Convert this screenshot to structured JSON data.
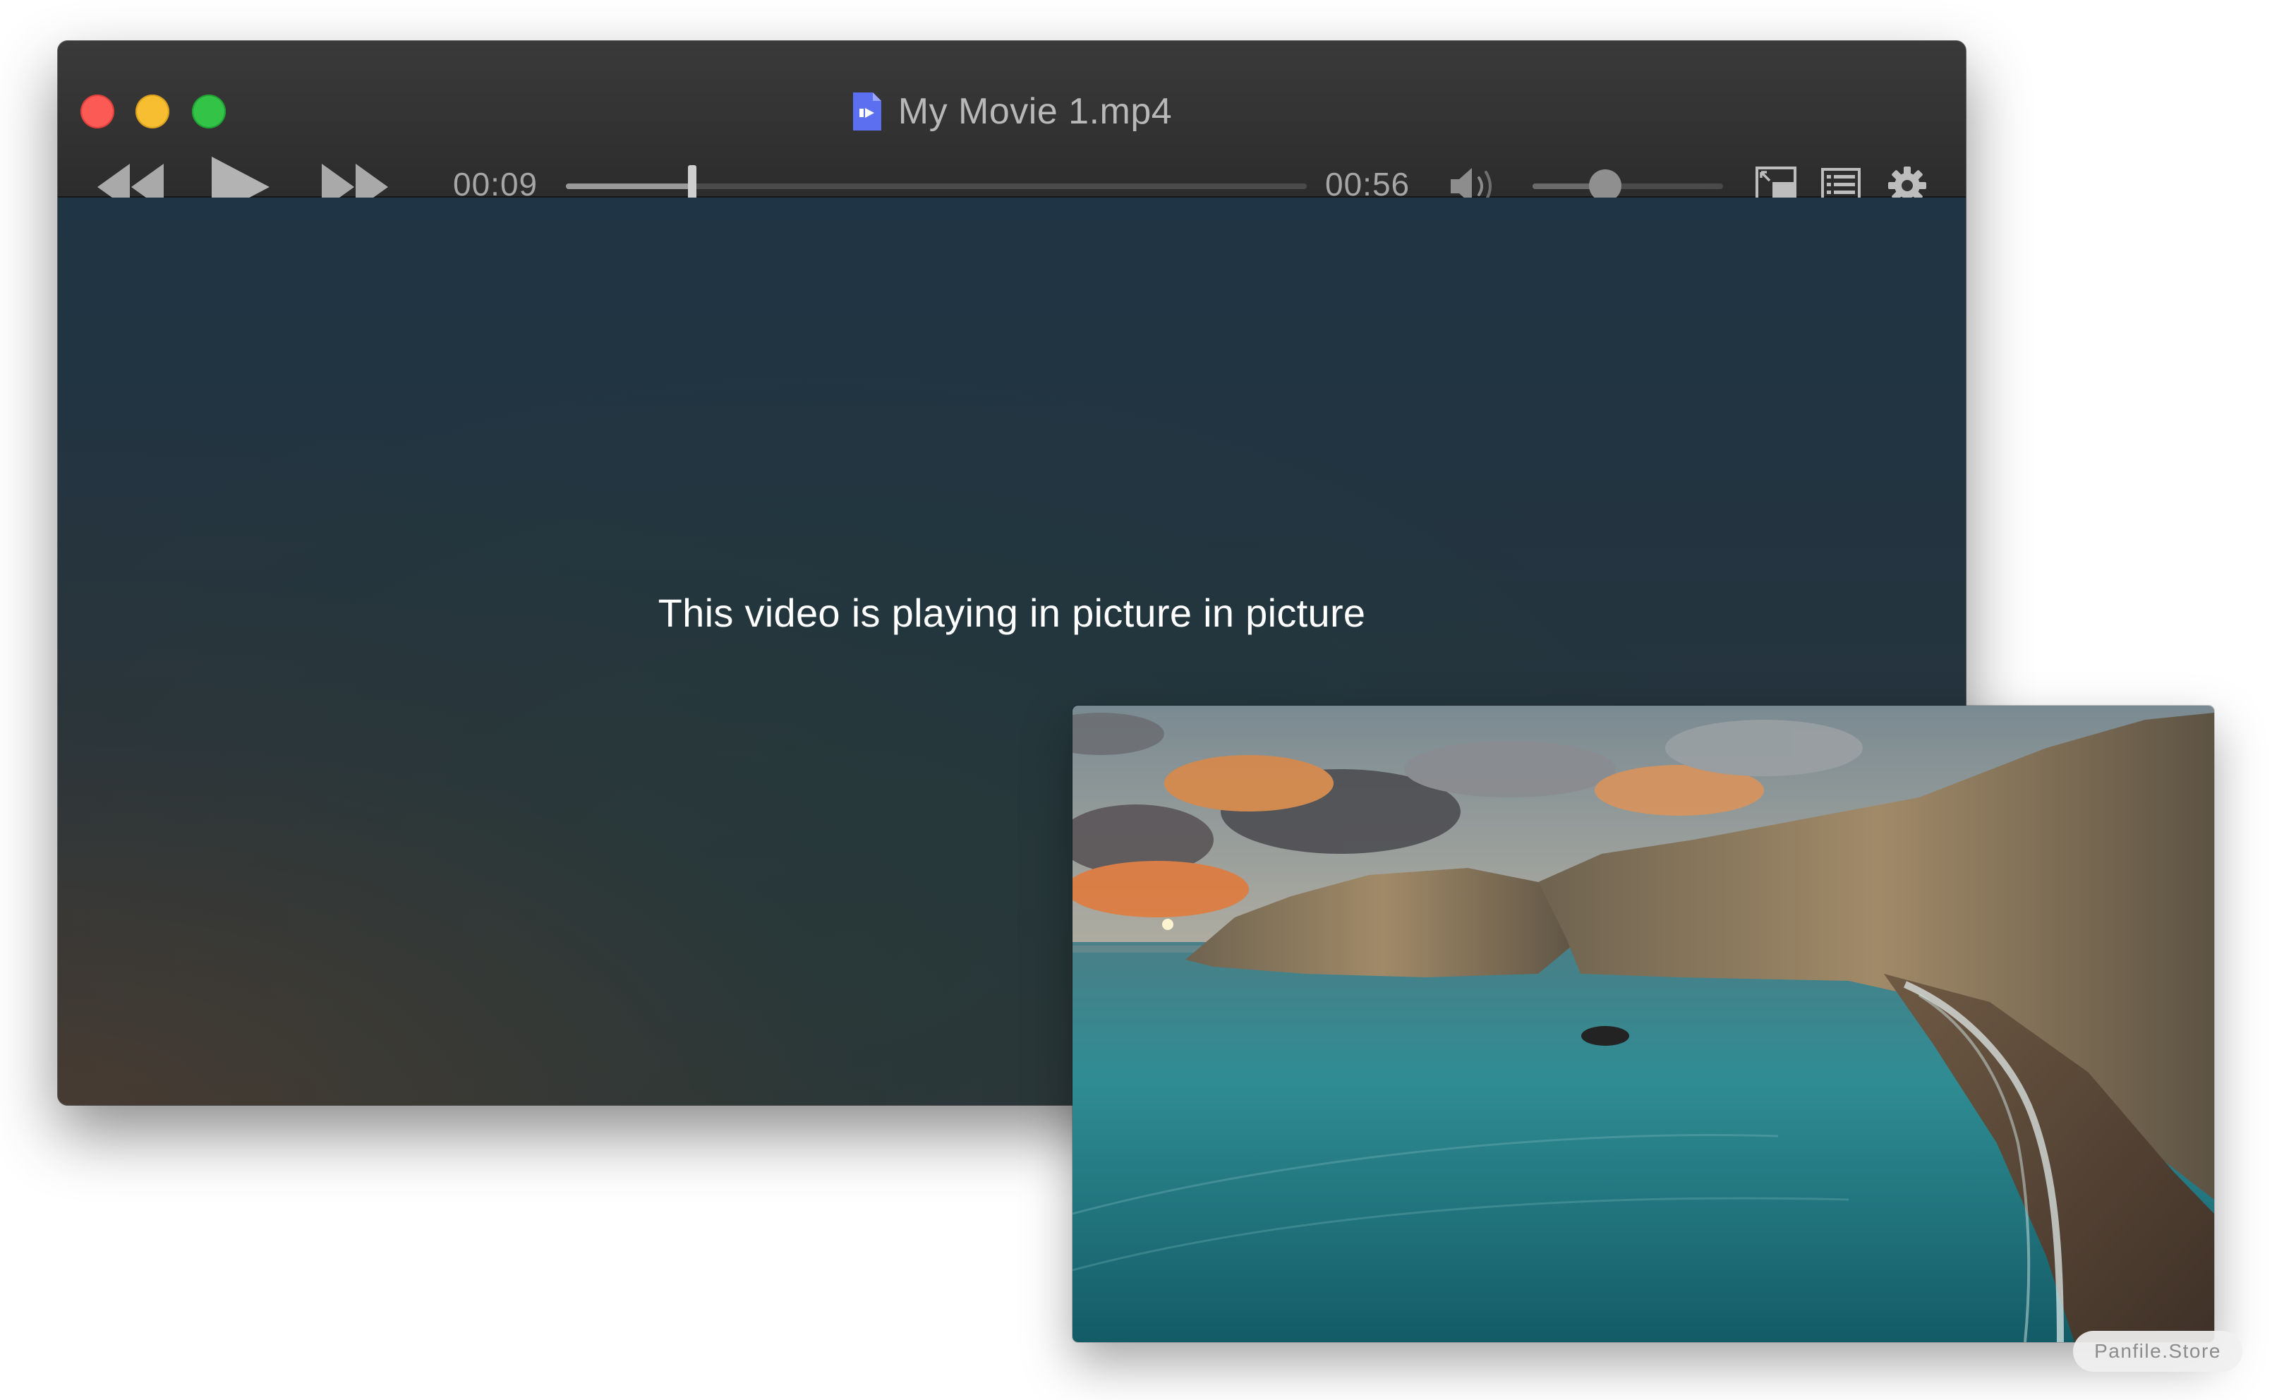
{
  "window": {
    "title": "My Movie 1.mp4",
    "title_icon": "video-document-icon"
  },
  "traffic_lights": {
    "close": "#fb5a55",
    "minimize": "#f6be30",
    "maximize": "#33c447"
  },
  "controls": {
    "rewind_icon": "rewind-icon",
    "play_icon": "play-icon",
    "fast_forward_icon": "fast-forward-icon",
    "current_time": "00:09",
    "total_time": "00:56",
    "progress_fraction": 0.17,
    "volume_icon": "speaker-volume-icon",
    "volume_fraction": 0.38,
    "pip_icon": "picture-in-picture-icon",
    "playlist_icon": "list-icon",
    "settings_icon": "gear-icon"
  },
  "player": {
    "message": "This video is playing in picture in picture"
  },
  "pip": {
    "content": "coastal cliff sunset scene"
  },
  "watermark": {
    "text": "Panfile.Store"
  }
}
